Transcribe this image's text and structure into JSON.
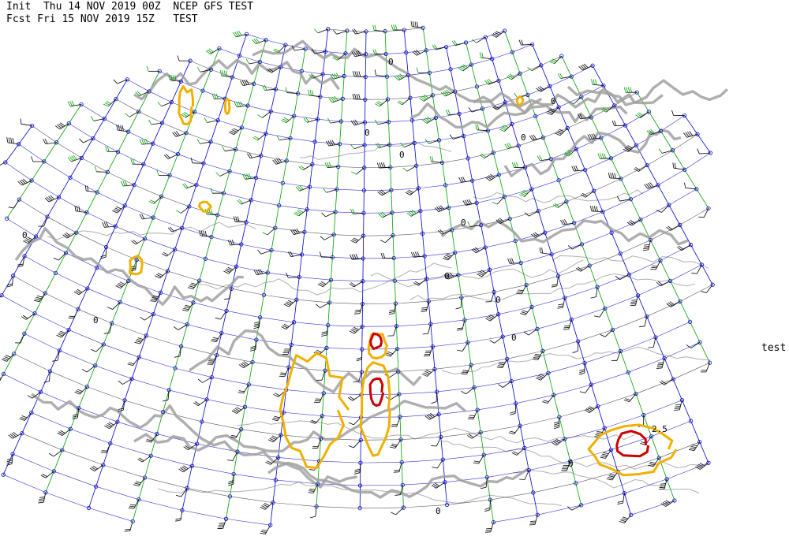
{
  "header": {
    "init_line": "Init  Thu 14 NOV 2019 00Z  NCEP GFS TEST",
    "fcst_line": "Fcst Fri 15 NOV 2019 15Z   TEST"
  },
  "side_label": "test",
  "contour_labels": [
    "0",
    "0",
    "0",
    "0",
    "0",
    "0",
    "0",
    "0",
    "0",
    "0",
    "0",
    "0",
    "0",
    "2.5"
  ],
  "colors": {
    "grid_green": "#00a000",
    "grid_blue": "#0000cc",
    "barbs": "#000000",
    "coastline": "#b0b0b0",
    "zero_contour": "#a0a0a0",
    "contour_yellow": "#f0b000",
    "contour_red": "#cc0000"
  }
}
